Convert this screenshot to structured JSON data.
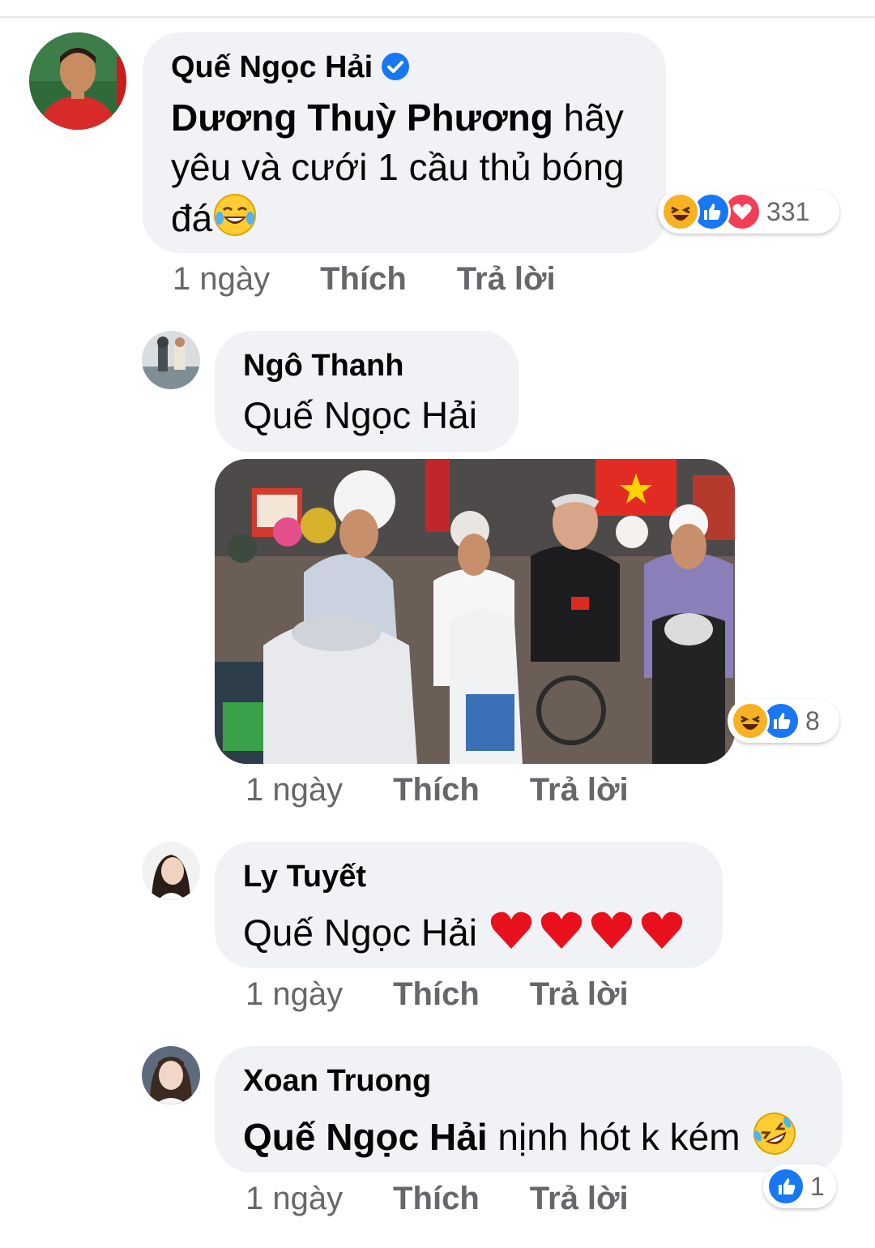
{
  "comments": [
    {
      "author": "Quế Ngọc Hải",
      "verified": true,
      "mention": "Dương Thuỳ Phương",
      "text_after_mention_line1": " hãy",
      "text_line2": "yêu và cưới 1 cầu thủ bóng",
      "text_line3": "đá",
      "time": "1 ngày",
      "like_label": "Thích",
      "reply_label": "Trả lời",
      "reaction_count": "331",
      "reactions": [
        "haha-icon",
        "like-icon",
        "love-icon"
      ]
    },
    {
      "author": "Ngô Thanh",
      "text": "Quế Ngọc Hải",
      "has_photo": true,
      "time": "1 ngày",
      "like_label": "Thích",
      "reply_label": "Trả lời",
      "reaction_count": "8",
      "reactions": [
        "haha-icon",
        "like-icon"
      ]
    },
    {
      "author": "Ly Tuyết",
      "text": "Quế Ngọc Hải",
      "hearts": 4,
      "time": "1 ngày",
      "like_label": "Thích",
      "reply_label": "Trả lời"
    },
    {
      "author": "Xoan Truong",
      "mention": "Quế Ngọc Hải",
      "text_after_mention": " nịnh hót k kém",
      "time": "1 ngày",
      "like_label": "Thích",
      "reply_label": "Trả lời",
      "reaction_count": "1",
      "reactions": [
        "like-icon"
      ]
    }
  ],
  "colors": {
    "bubble": "#f0f2f5",
    "meta_text": "#65676b",
    "like_blue": "#1877f2",
    "love_red": "#f33e58",
    "haha_yellow": "#f7b125"
  }
}
